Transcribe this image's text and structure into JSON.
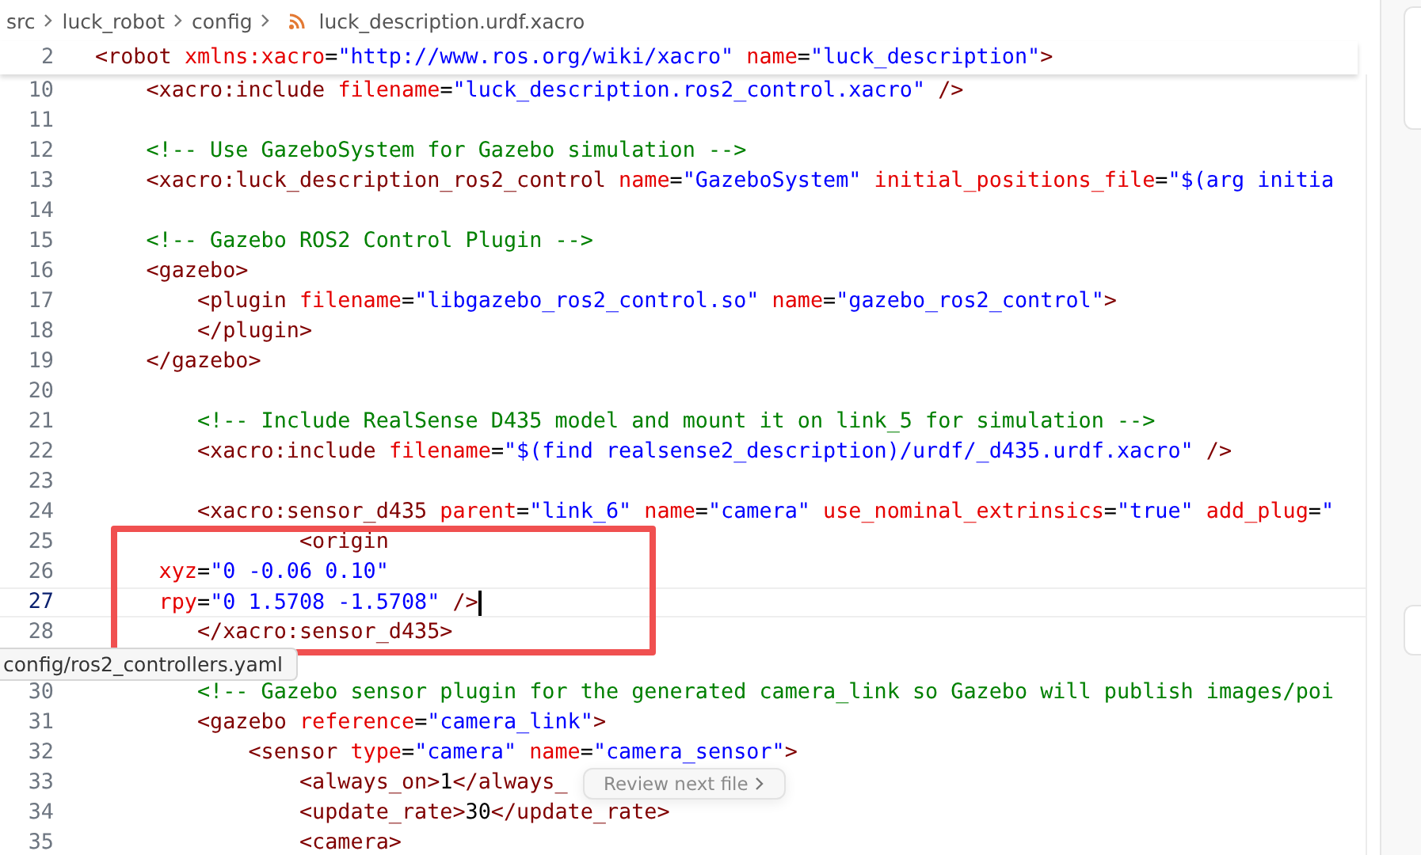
{
  "breadcrumb": [
    "src",
    "luck_robot",
    "config",
    "luck_description.urdf.xacro"
  ],
  "sticky_line": {
    "number": "2",
    "tokens": [
      {
        "kind": "tag",
        "text": "<robot "
      },
      {
        "kind": "attr",
        "text": "xmlns:xacro"
      },
      {
        "kind": "plain",
        "text": "="
      },
      {
        "kind": "value",
        "text": "\"http://www.ros.org/wiki/xacro\" "
      },
      {
        "kind": "attr",
        "text": "name"
      },
      {
        "kind": "plain",
        "text": "="
      },
      {
        "kind": "value",
        "text": "\"luck_description\""
      },
      {
        "kind": "tag",
        "text": ">"
      }
    ]
  },
  "lines": [
    {
      "kind": "code",
      "number": "10",
      "current": false,
      "tokens": [
        {
          "kind": "tag",
          "text": "    <xacro:include "
        },
        {
          "kind": "attr",
          "text": "filename"
        },
        {
          "kind": "plain",
          "text": "="
        },
        {
          "kind": "value",
          "text": "\"luck_description.ros2_control.xacro\""
        },
        {
          "kind": "tag",
          "text": " />"
        }
      ]
    },
    {
      "kind": "code",
      "number": "11",
      "current": false
    },
    {
      "kind": "code",
      "number": "12",
      "current": false,
      "tokens": [
        {
          "kind": "comment",
          "text": "    <!-- Use GazeboSystem for Gazebo simulation -->"
        }
      ]
    },
    {
      "kind": "code",
      "number": "13",
      "current": false,
      "tokens": [
        {
          "kind": "tag",
          "text": "    <xacro:luck_description_ros2_control "
        },
        {
          "kind": "attr",
          "text": "name"
        },
        {
          "kind": "plain",
          "text": "="
        },
        {
          "kind": "value",
          "text": "\"GazeboSystem\" "
        },
        {
          "kind": "attr",
          "text": "initial_positions_file"
        },
        {
          "kind": "plain",
          "text": "="
        },
        {
          "kind": "value",
          "text": "\"$(arg initia"
        }
      ]
    },
    {
      "kind": "code",
      "number": "14",
      "current": false
    },
    {
      "kind": "code",
      "number": "15",
      "current": false,
      "tokens": [
        {
          "kind": "comment",
          "text": "    <!-- Gazebo ROS2 Control Plugin -->"
        }
      ]
    },
    {
      "kind": "code",
      "number": "16",
      "current": false,
      "tokens": [
        {
          "kind": "tag",
          "text": "    <gazebo>"
        }
      ]
    },
    {
      "kind": "code",
      "number": "17",
      "current": false,
      "tokens": [
        {
          "kind": "tag",
          "text": "        <plugin "
        },
        {
          "kind": "attr",
          "text": "filename"
        },
        {
          "kind": "plain",
          "text": "="
        },
        {
          "kind": "value",
          "text": "\"libgazebo_ros2_control.so\" "
        },
        {
          "kind": "attr",
          "text": "name"
        },
        {
          "kind": "plain",
          "text": "="
        },
        {
          "kind": "value",
          "text": "\"gazebo_ros2_control\""
        },
        {
          "kind": "tag",
          "text": ">"
        }
      ]
    },
    {
      "kind": "code",
      "number": "18",
      "current": false,
      "tokens": [
        {
          "kind": "tag",
          "text": "        </plugin>"
        }
      ]
    },
    {
      "kind": "code",
      "number": "19",
      "current": false,
      "tokens": [
        {
          "kind": "tag",
          "text": "    </gazebo>"
        }
      ]
    },
    {
      "kind": "code",
      "number": "20",
      "current": false
    },
    {
      "kind": "code",
      "number": "21",
      "current": false,
      "tokens": [
        {
          "kind": "comment",
          "text": "        <!-- Include RealSense D435 model and mount it on link_5 for simulation -->"
        }
      ]
    },
    {
      "kind": "code",
      "number": "22",
      "current": false,
      "tokens": [
        {
          "kind": "tag",
          "text": "        <xacro:include "
        },
        {
          "kind": "attr",
          "text": "filename"
        },
        {
          "kind": "plain",
          "text": "="
        },
        {
          "kind": "value",
          "text": "\"$(find realsense2_description)/urdf/_d435.urdf.xacro\""
        },
        {
          "kind": "tag",
          "text": " />"
        }
      ]
    },
    {
      "kind": "code",
      "number": "23",
      "current": false
    },
    {
      "kind": "code",
      "number": "24",
      "current": false,
      "tokens": [
        {
          "kind": "tag",
          "text": "        <xacro:sensor_d435 "
        },
        {
          "kind": "attr",
          "text": "parent"
        },
        {
          "kind": "plain",
          "text": "="
        },
        {
          "kind": "value",
          "text": "\"link_6\" "
        },
        {
          "kind": "attr",
          "text": "name"
        },
        {
          "kind": "plain",
          "text": "="
        },
        {
          "kind": "value",
          "text": "\"camera\" "
        },
        {
          "kind": "attr",
          "text": "use_nominal_extrinsics"
        },
        {
          "kind": "plain",
          "text": "="
        },
        {
          "kind": "value",
          "text": "\"true\" "
        },
        {
          "kind": "attr",
          "text": "add_plug"
        },
        {
          "kind": "plain",
          "text": "="
        },
        {
          "kind": "value",
          "text": "\""
        }
      ]
    },
    {
      "kind": "code",
      "number": "25",
      "current": false,
      "tokens": [
        {
          "kind": "tag",
          "text": "                <origin"
        }
      ]
    },
    {
      "kind": "code",
      "number": "26",
      "current": false,
      "tokens": [
        {
          "kind": "attr",
          "text": "     xyz"
        },
        {
          "kind": "plain",
          "text": "="
        },
        {
          "kind": "value",
          "text": "\"0 -0.06 0.10\""
        }
      ]
    },
    {
      "kind": "code",
      "number": "27",
      "current": true,
      "tokens": [
        {
          "kind": "attr",
          "text": "     rpy"
        },
        {
          "kind": "plain",
          "text": "="
        },
        {
          "kind": "value",
          "text": "\"0 1.5708 -1.5708\""
        },
        {
          "kind": "tag",
          "text": " />"
        }
      ]
    },
    {
      "kind": "code",
      "number": "28",
      "current": false,
      "tokens": [
        {
          "kind": "tag",
          "text": "        </xacro:sensor_d435>"
        }
      ]
    },
    {
      "kind": "tooltip",
      "text": "config/ros2_controllers.yaml"
    },
    {
      "kind": "code",
      "number": "30",
      "current": false,
      "tokens": [
        {
          "kind": "comment",
          "text": "        <!-- Gazebo sensor plugin for the generated camera_link so Gazebo will publish images/poi"
        }
      ]
    },
    {
      "kind": "code",
      "number": "31",
      "current": false,
      "tokens": [
        {
          "kind": "tag",
          "text": "        <gazebo "
        },
        {
          "kind": "attr",
          "text": "reference"
        },
        {
          "kind": "plain",
          "text": "="
        },
        {
          "kind": "value",
          "text": "\"camera_link\""
        },
        {
          "kind": "tag",
          "text": ">"
        }
      ]
    },
    {
      "kind": "code",
      "number": "32",
      "current": false,
      "tokens": [
        {
          "kind": "tag",
          "text": "            <sensor "
        },
        {
          "kind": "attr",
          "text": "type"
        },
        {
          "kind": "plain",
          "text": "="
        },
        {
          "kind": "value",
          "text": "\"camera\" "
        },
        {
          "kind": "attr",
          "text": "name"
        },
        {
          "kind": "plain",
          "text": "="
        },
        {
          "kind": "value",
          "text": "\"camera_sensor\""
        },
        {
          "kind": "tag",
          "text": ">"
        }
      ]
    },
    {
      "kind": "code",
      "number": "33",
      "current": false,
      "tokens": [
        {
          "kind": "tag",
          "text": "                <always_on>"
        },
        {
          "kind": "plain",
          "text": "1"
        },
        {
          "kind": "tag",
          "text": "</always_"
        }
      ]
    },
    {
      "kind": "code",
      "number": "34",
      "current": false,
      "tokens": [
        {
          "kind": "tag",
          "text": "                <update_rate>"
        },
        {
          "kind": "plain",
          "text": "30"
        },
        {
          "kind": "tag",
          "text": "</update_rate>"
        }
      ]
    },
    {
      "kind": "code",
      "number": "35",
      "current": false,
      "tokens": [
        {
          "kind": "tag",
          "text": "                <camera>"
        }
      ]
    }
  ],
  "review_button": "Review next file"
}
